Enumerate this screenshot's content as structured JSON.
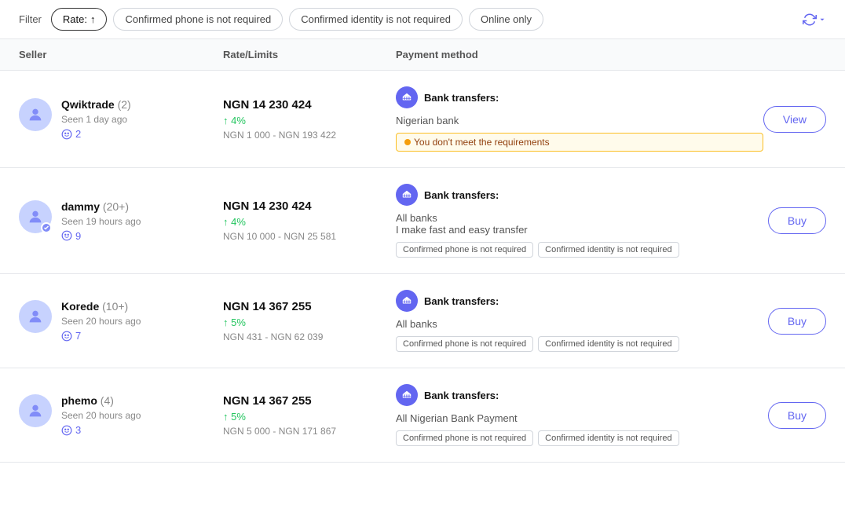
{
  "filter": {
    "label": "Filter",
    "rate_label": "Rate:",
    "rate_arrow": "↑",
    "tags": [
      "Confirmed phone is not required",
      "Confirmed identity is not required",
      "Online only"
    ]
  },
  "table": {
    "columns": [
      "Seller",
      "Rate/Limits",
      "Payment method"
    ],
    "rows": [
      {
        "seller_name": "Qwiktrade",
        "seller_count": "(2)",
        "seen": "Seen 1 day ago",
        "feedback": "2",
        "verified": false,
        "rate": "NGN 14 230 424",
        "pct": "↑ 4%",
        "range": "NGN 1 000 - NGN 193 422",
        "payment_label": "Bank transfers:",
        "payment_sub": "Nigerian bank",
        "warning": "You don't meet the requirements",
        "req_tags": [],
        "action": "View"
      },
      {
        "seller_name": "dammy",
        "seller_count": "(20+)",
        "seen": "Seen 19 hours ago",
        "feedback": "9",
        "verified": true,
        "rate": "NGN 14 230 424",
        "pct": "↑ 4%",
        "range": "NGN 10 000 - NGN 25 581",
        "payment_label": "Bank transfers:",
        "payment_sub": "All banks\nI make fast and easy transfer",
        "warning": null,
        "req_tags": [
          "Confirmed phone is not required",
          "Confirmed identity is not required"
        ],
        "action": "Buy"
      },
      {
        "seller_name": "Korede",
        "seller_count": "(10+)",
        "seen": "Seen 20 hours ago",
        "feedback": "7",
        "verified": false,
        "rate": "NGN 14 367 255",
        "pct": "↑ 5%",
        "range": "NGN 431 - NGN 62 039",
        "payment_label": "Bank transfers:",
        "payment_sub": "All banks",
        "warning": null,
        "req_tags": [
          "Confirmed phone is not required",
          "Confirmed identity is not required"
        ],
        "action": "Buy"
      },
      {
        "seller_name": "phemo",
        "seller_count": "(4)",
        "seen": "Seen 20 hours ago",
        "feedback": "3",
        "verified": false,
        "rate": "NGN 14 367 255",
        "pct": "↑ 5%",
        "range": "NGN 5 000 - NGN 171 867",
        "payment_label": "Bank transfers:",
        "payment_sub": "All Nigerian Bank Payment",
        "warning": null,
        "req_tags": [
          "Confirmed phone is not required",
          "Confirmed identity is not required"
        ],
        "action": "Buy"
      }
    ]
  }
}
